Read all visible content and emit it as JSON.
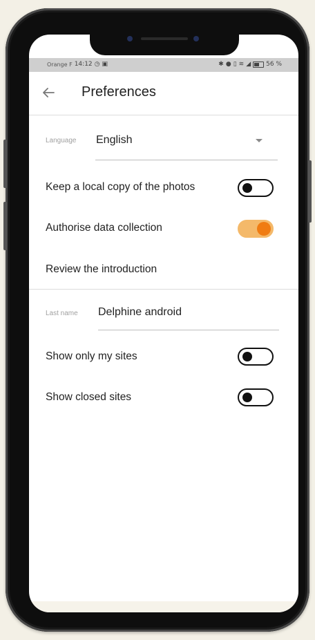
{
  "status_bar": {
    "carrier": "Orange F",
    "time": "14:12",
    "battery": "56 %"
  },
  "app_bar": {
    "title": "Preferences"
  },
  "language_field": {
    "label": "Language",
    "value": "English"
  },
  "settings": {
    "local_copy": {
      "label": "Keep a local copy of the photos",
      "on": false
    },
    "data_collection": {
      "label": "Authorise data collection",
      "on": true
    },
    "review_intro": {
      "label": "Review the introduction"
    }
  },
  "last_name_field": {
    "label": "Last name",
    "value": "Delphine android"
  },
  "site_filters": {
    "only_my_sites": {
      "label": "Show only my sites",
      "on": false
    },
    "closed_sites": {
      "label": "Show closed sites",
      "on": false
    }
  },
  "colors": {
    "accent": "#f07c12",
    "accent_track": "#f4b96a"
  },
  "icons": {
    "back": "arrow-left-icon",
    "dropdown": "caret-down-icon"
  }
}
